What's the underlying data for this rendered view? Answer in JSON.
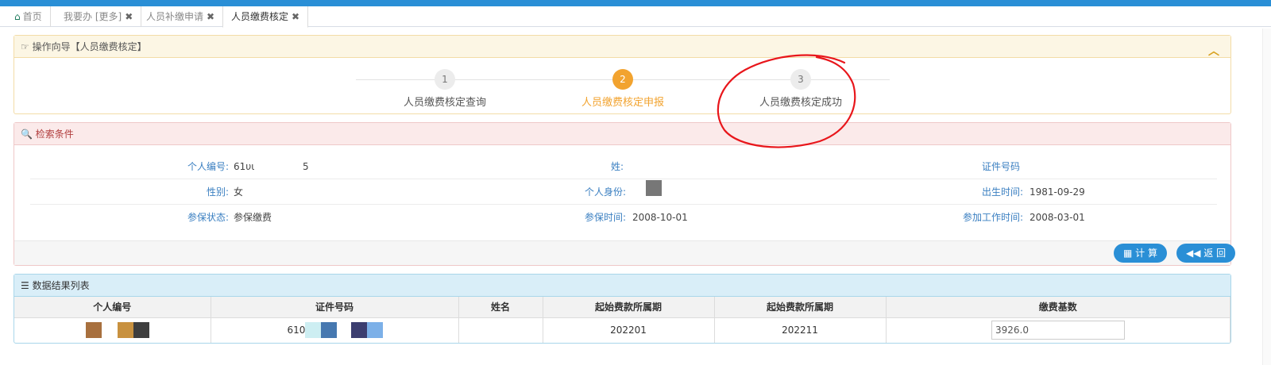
{
  "tabs": [
    {
      "label": "首页",
      "closable": false
    },
    {
      "label": "我要办 [更多]",
      "closable": true
    },
    {
      "label": "人员补缴申请",
      "closable": true
    },
    {
      "label": "人员缴费核定",
      "closable": true
    }
  ],
  "guide": {
    "title": "操作向导【人员缴费核定】",
    "steps": [
      {
        "num": "1",
        "label": "人员缴费核定查询"
      },
      {
        "num": "2",
        "label": "人员缴费核定申报"
      },
      {
        "num": "3",
        "label": "人员缴费核定成功"
      }
    ],
    "current_step": 2
  },
  "search": {
    "title": "检索条件",
    "fields": {
      "personal_no": {
        "label": "个人编号:",
        "value": "61υι",
        "value2": "5"
      },
      "name": {
        "label": "姓:",
        "value": ""
      },
      "id_no": {
        "label": "证件号码",
        "value": ""
      },
      "gender": {
        "label": "性别:",
        "value": "女"
      },
      "identity": {
        "label": "个人身份:",
        "value": ""
      },
      "birth": {
        "label": "出生时间:",
        "value": "1981-09-29"
      },
      "ins_status": {
        "label": "参保状态:",
        "value": "参保缴费"
      },
      "ins_time": {
        "label": "参保时间:",
        "value": "2008-10-01"
      },
      "work_time": {
        "label": "参加工作时间:",
        "value": "2008-03-01"
      }
    },
    "buttons": {
      "calc": "计 算",
      "back": "返 回"
    }
  },
  "results": {
    "title": "数据结果列表",
    "columns": [
      "个人编号",
      "证件号码",
      "姓名",
      "起始费款所属期",
      "起始费款所属期",
      "缴费基数"
    ],
    "rows": [
      {
        "personal_no": "",
        "id_no": "610",
        "name": "",
        "start": "202201",
        "end": "202211",
        "base": "3926.0"
      }
    ]
  },
  "colors": {
    "accent": "#2a8fd6",
    "current_step": "#f2a32f",
    "annotation": "#e8161b"
  }
}
